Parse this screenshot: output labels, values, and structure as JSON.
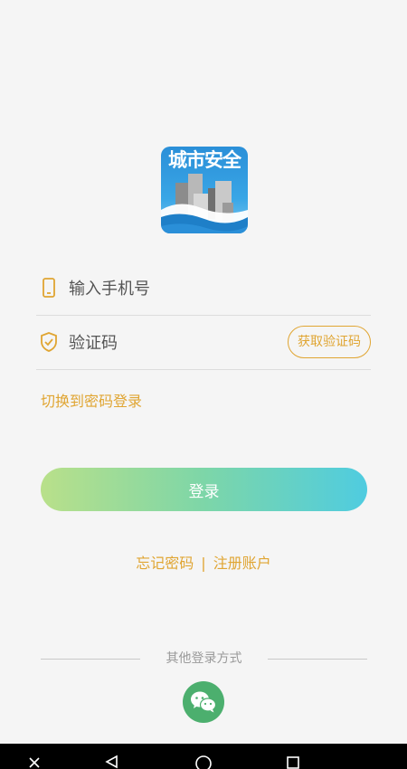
{
  "app": {
    "logo_text": "城市安全"
  },
  "form": {
    "phone_placeholder": "输入手机号",
    "code_placeholder": "验证码",
    "get_code_label": "获取验证码",
    "switch_label": "切换到密码登录",
    "login_label": "登录"
  },
  "links": {
    "forgot": "忘记密码",
    "separator": "|",
    "register": "注册账户"
  },
  "other": {
    "label": "其他登录方式",
    "wechat_icon": "wechat-icon"
  },
  "colors": {
    "accent": "#e0a532",
    "background": "#f5f5f5",
    "wechat": "#4caf6e",
    "button_gradient_start": "#b9e08a",
    "button_gradient_end": "#4fcce0"
  },
  "navbar": {
    "items": [
      "back-icon",
      "home-icon",
      "recents-icon",
      "menu-icon"
    ]
  }
}
